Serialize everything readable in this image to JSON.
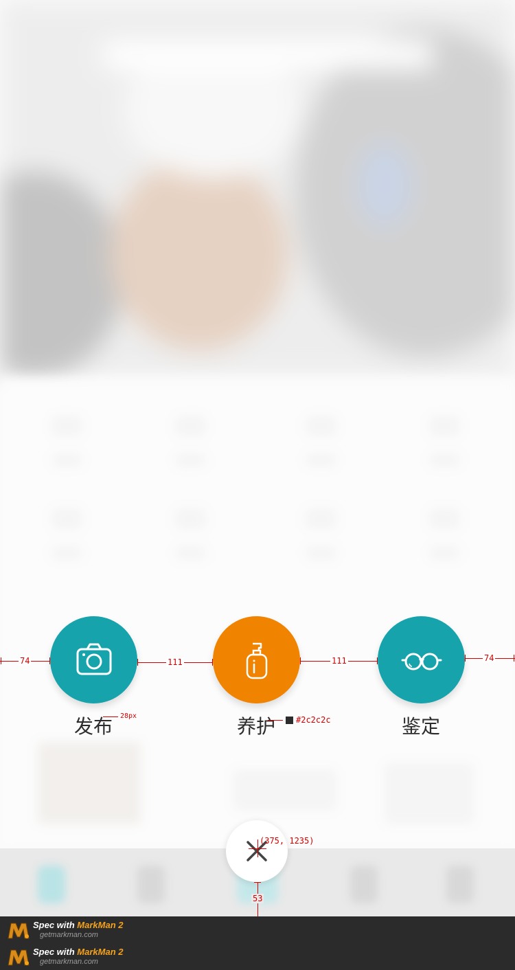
{
  "actions": [
    {
      "label": "发布",
      "icon": "camera-icon",
      "color": "#17a3ac"
    },
    {
      "label": "养护",
      "icon": "lotion-bottle-icon",
      "color": "#f08300"
    },
    {
      "label": "鉴定",
      "icon": "glasses-icon",
      "color": "#17a3ac"
    }
  ],
  "close_button": {
    "icon": "close-icon"
  },
  "annotations": {
    "left_margin": "74",
    "gap_1": "111",
    "gap_2": "111",
    "right_margin": "74",
    "font_size": "28px",
    "text_color": "#2c2c2c",
    "center_point": "(375, 1235)",
    "bottom_offset": "53"
  },
  "footer": {
    "rows": [
      {
        "prefix": "Spec with ",
        "brand": "MarkMan 2",
        "url": "getmarkman.com"
      },
      {
        "prefix": "Spec with ",
        "brand": "MarkMan 2",
        "url": "getmarkman.com"
      }
    ]
  },
  "colors": {
    "teal": "#17a3ac",
    "orange": "#f08300",
    "spec_red": "#d40000",
    "footer_bg": "#2b2b2b",
    "brand_orange": "#f4a21c"
  }
}
